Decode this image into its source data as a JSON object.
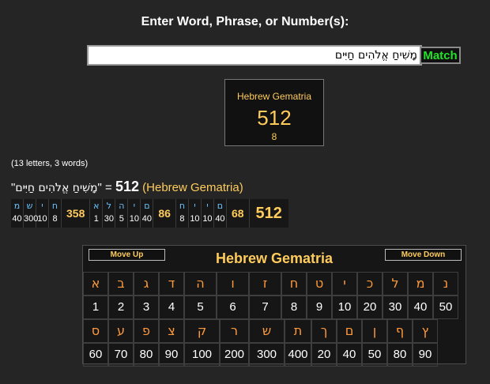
{
  "prompt_label": "Enter Word, Phrase, or Number(s):",
  "input": {
    "value": "מָשִׁיחַ אֱלֹהִים חַיִּים"
  },
  "match_button": "Match",
  "result": {
    "cipher": "Hebrew Gematria",
    "value": "512",
    "reduced": "8"
  },
  "stats": "(13 letters, 3 words)",
  "summary": {
    "open_quote": "\"",
    "phrase": "מָשִׁיחַ אֱלֹהִים חַיִּים",
    "close_eq": "\" = ",
    "value": "512",
    "cipher": "(Hebrew Gematria)"
  },
  "breakdown": {
    "words": [
      {
        "letters": [
          {
            "h": "מ",
            "v": "40"
          },
          {
            "h": "ש",
            "v": "300"
          },
          {
            "h": "י",
            "v": "10"
          },
          {
            "h": "ח",
            "v": "8"
          }
        ],
        "sum": "358"
      },
      {
        "letters": [
          {
            "h": "א",
            "v": "1"
          },
          {
            "h": "ל",
            "v": "30"
          },
          {
            "h": "ה",
            "v": "5"
          },
          {
            "h": "י",
            "v": "10"
          },
          {
            "h": "ם",
            "v": "40"
          }
        ],
        "sum": "86"
      },
      {
        "letters": [
          {
            "h": "ח",
            "v": "8"
          },
          {
            "h": "י",
            "v": "10"
          },
          {
            "h": "י",
            "v": "10"
          },
          {
            "h": "ם",
            "v": "40"
          }
        ],
        "sum": "68"
      }
    ],
    "total": "512"
  },
  "table": {
    "title": "Hebrew Gematria",
    "move_up": "Move Up",
    "move_down": "Move Down",
    "row1_letters": [
      "א",
      "ב",
      "ג",
      "ד",
      "ה",
      "ו",
      "ז",
      "ח",
      "ט",
      "י",
      "כ",
      "ל",
      "מ",
      "נ"
    ],
    "row1_values": [
      "1",
      "2",
      "3",
      "4",
      "5",
      "6",
      "7",
      "8",
      "9",
      "10",
      "20",
      "30",
      "40",
      "50"
    ],
    "row2_letters": [
      "ס",
      "ע",
      "פ",
      "צ",
      "ק",
      "ר",
      "ש",
      "ת",
      "ך",
      "ם",
      "ן",
      "ף",
      "ץ"
    ],
    "row2_values": [
      "60",
      "70",
      "80",
      "90",
      "100",
      "200",
      "300",
      "400",
      "20",
      "40",
      "50",
      "80",
      "90"
    ]
  }
}
